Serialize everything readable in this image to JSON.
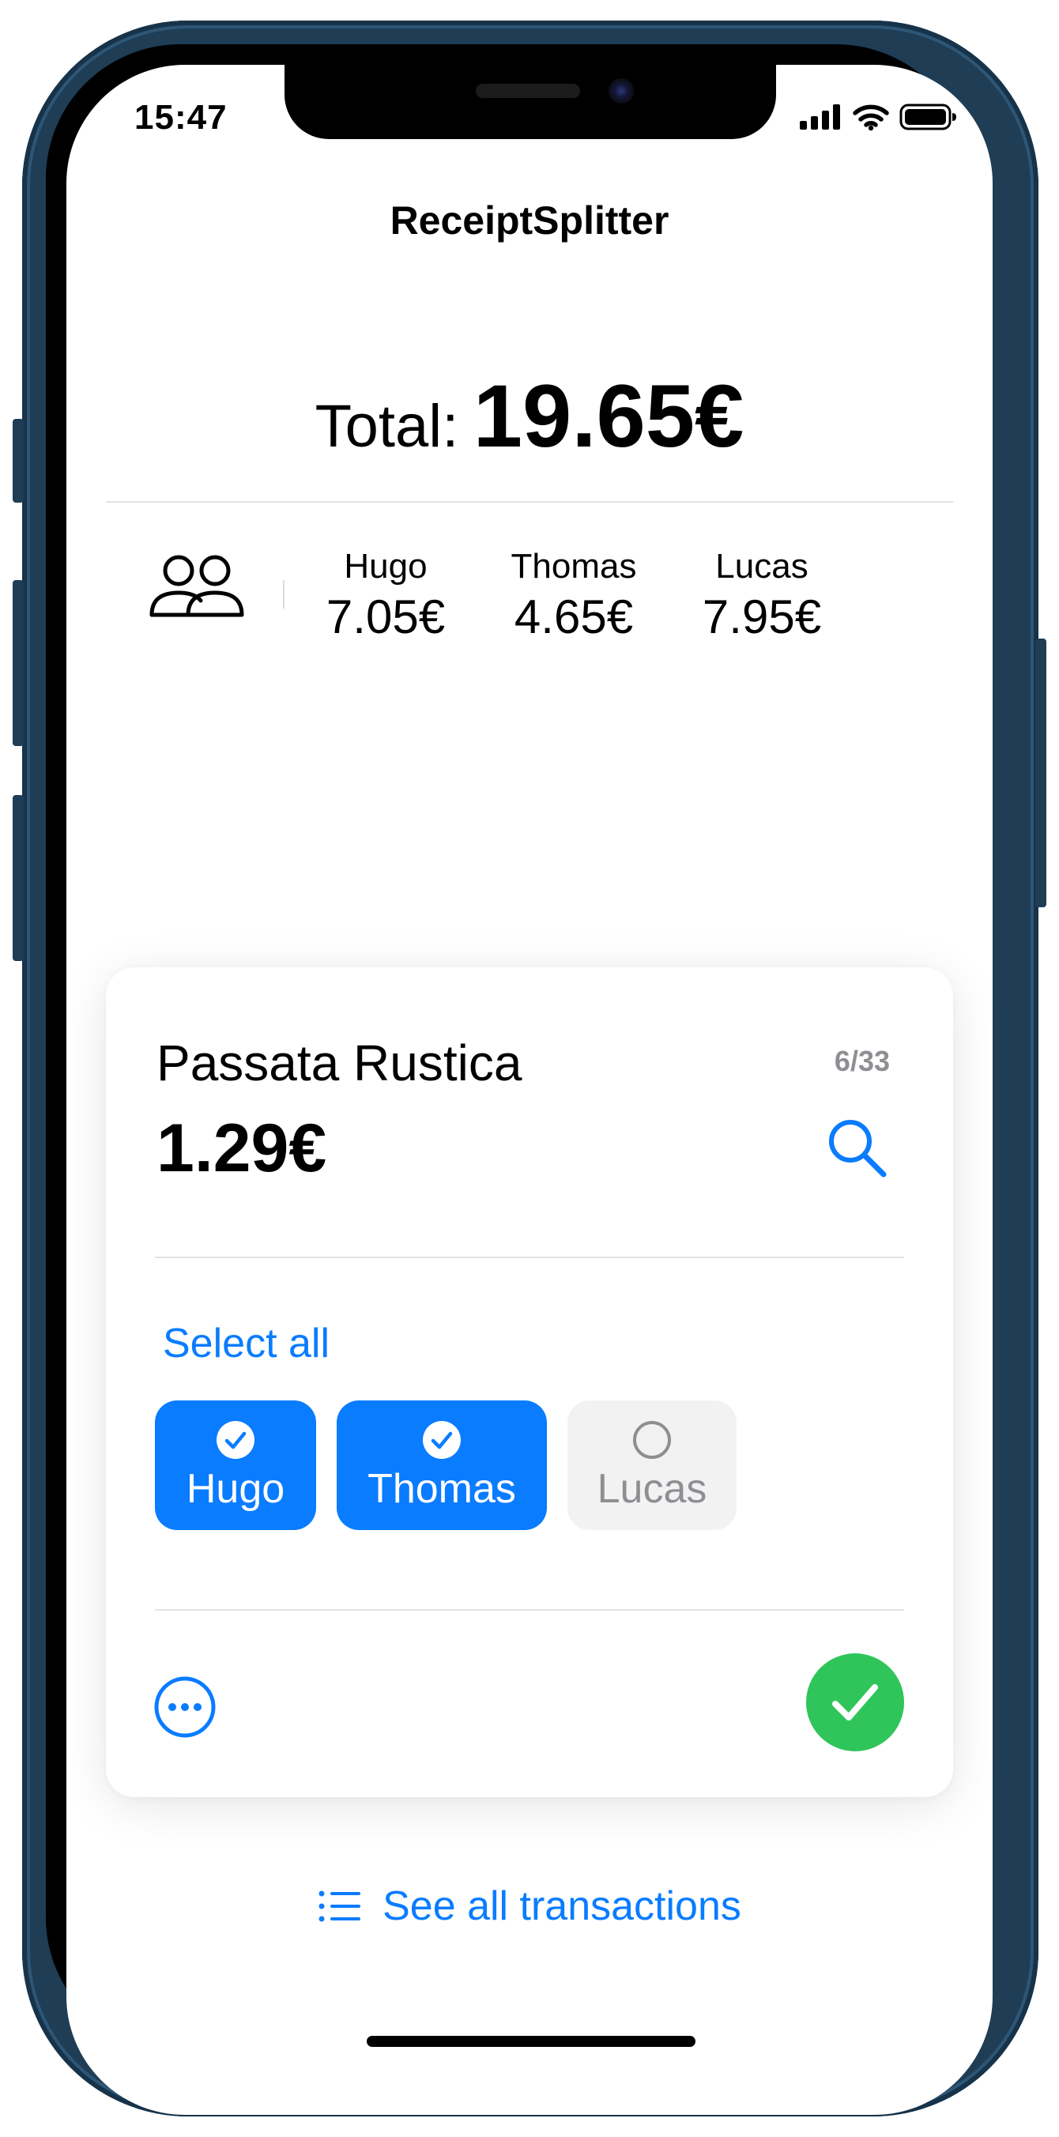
{
  "status_bar": {
    "time": "15:47",
    "icons": [
      "cellular-signal-icon",
      "wifi-icon",
      "battery-icon"
    ]
  },
  "header": {
    "title": "ReceiptSplitter"
  },
  "total": {
    "label": "Total:",
    "value": "19.65€"
  },
  "people": [
    {
      "name": "Hugo",
      "amount": "7.05€"
    },
    {
      "name": "Thomas",
      "amount": "4.65€"
    },
    {
      "name": "Lucas",
      "amount": "7.95€"
    }
  ],
  "item_card": {
    "name": "Passata Rustica",
    "counter": "6/33",
    "price": "1.29€",
    "select_all_label": "Select all",
    "participants": [
      {
        "name": "Hugo",
        "selected": true
      },
      {
        "name": "Thomas",
        "selected": true
      },
      {
        "name": "Lucas",
        "selected": false
      }
    ]
  },
  "footer": {
    "see_all_label": "See all transactions"
  },
  "colors": {
    "accent_blue": "#0a7cff",
    "confirm_green": "#2fc55a",
    "muted_gray": "#8e8e93",
    "phone_frame": "#1f3d55"
  }
}
